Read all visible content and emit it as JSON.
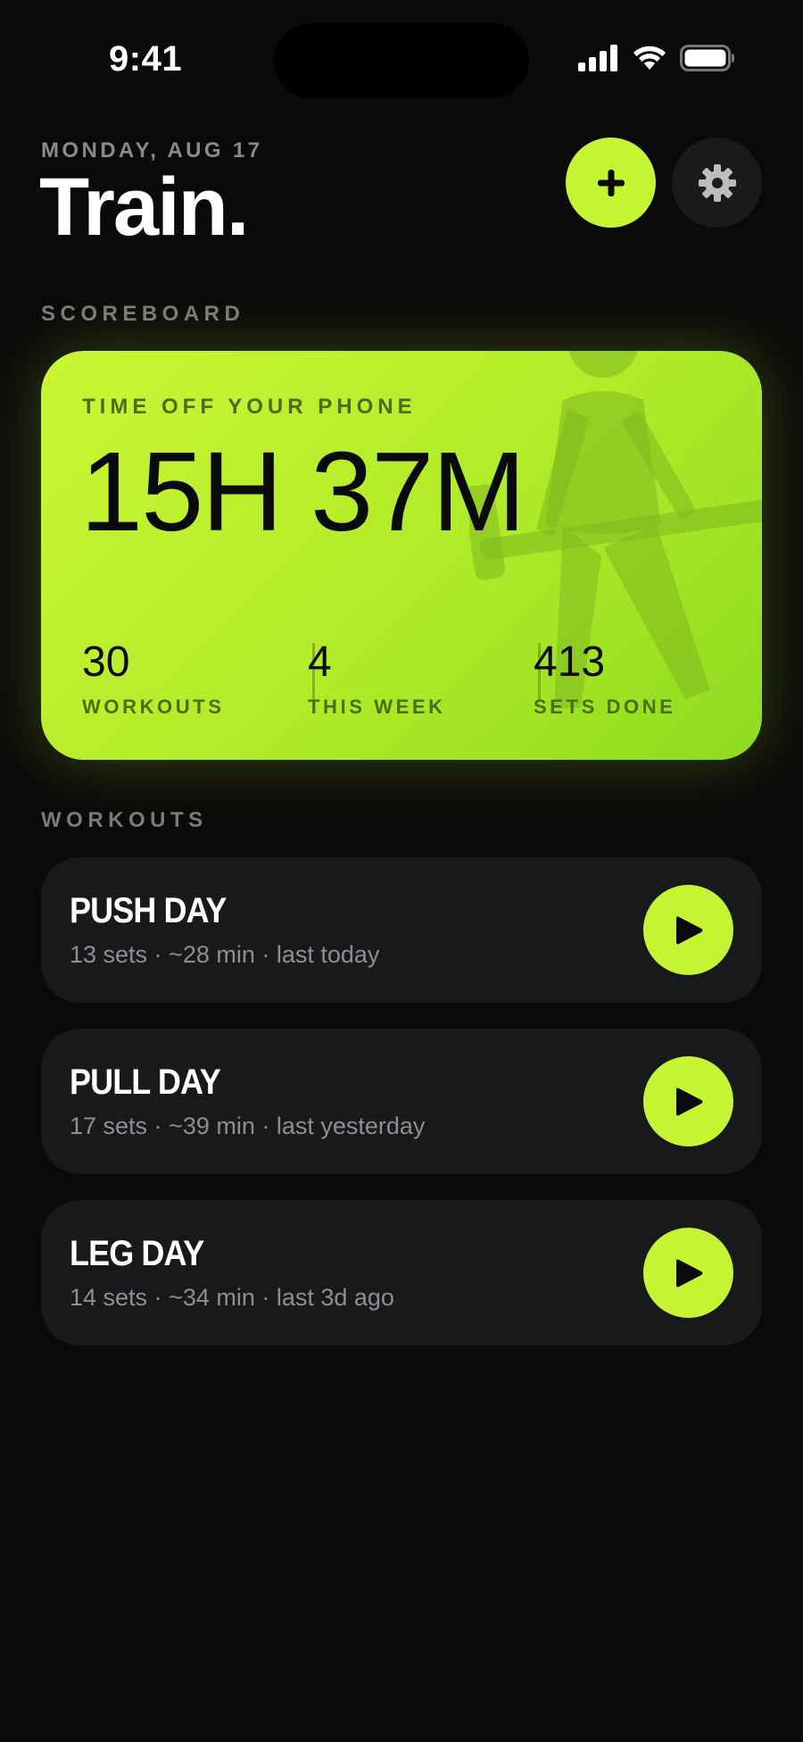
{
  "status_bar": {
    "time": "9:41",
    "icons": [
      "signal-icon",
      "wifi-icon",
      "battery-icon"
    ]
  },
  "header": {
    "date": "MONDAY, AUG 17",
    "title": "Train.",
    "add_icon": "plus-icon",
    "settings_icon": "gear-icon"
  },
  "scoreboard": {
    "section_label": "SCOREBOARD",
    "card_label": "TIME OFF YOUR PHONE",
    "time_off_phone": "15H 37M",
    "stats": [
      {
        "value": "30",
        "label": "WORKOUTS"
      },
      {
        "value": "4",
        "label": "THIS WEEK"
      },
      {
        "value": "413",
        "label": "SETS DONE"
      }
    ]
  },
  "workouts": {
    "section_label": "WORKOUTS",
    "items": [
      {
        "name": "PUSH DAY",
        "meta": "13 sets · ~28 min · last today"
      },
      {
        "name": "PULL DAY",
        "meta": "17 sets · ~39 min · last yesterday"
      },
      {
        "name": "LEG DAY",
        "meta": "14 sets · ~34 min · last 3d ago"
      }
    ]
  },
  "colors": {
    "accent": "#c5f433",
    "background": "#0a0a0a",
    "card": "#18191b",
    "muted_text": "#8e8e93"
  }
}
